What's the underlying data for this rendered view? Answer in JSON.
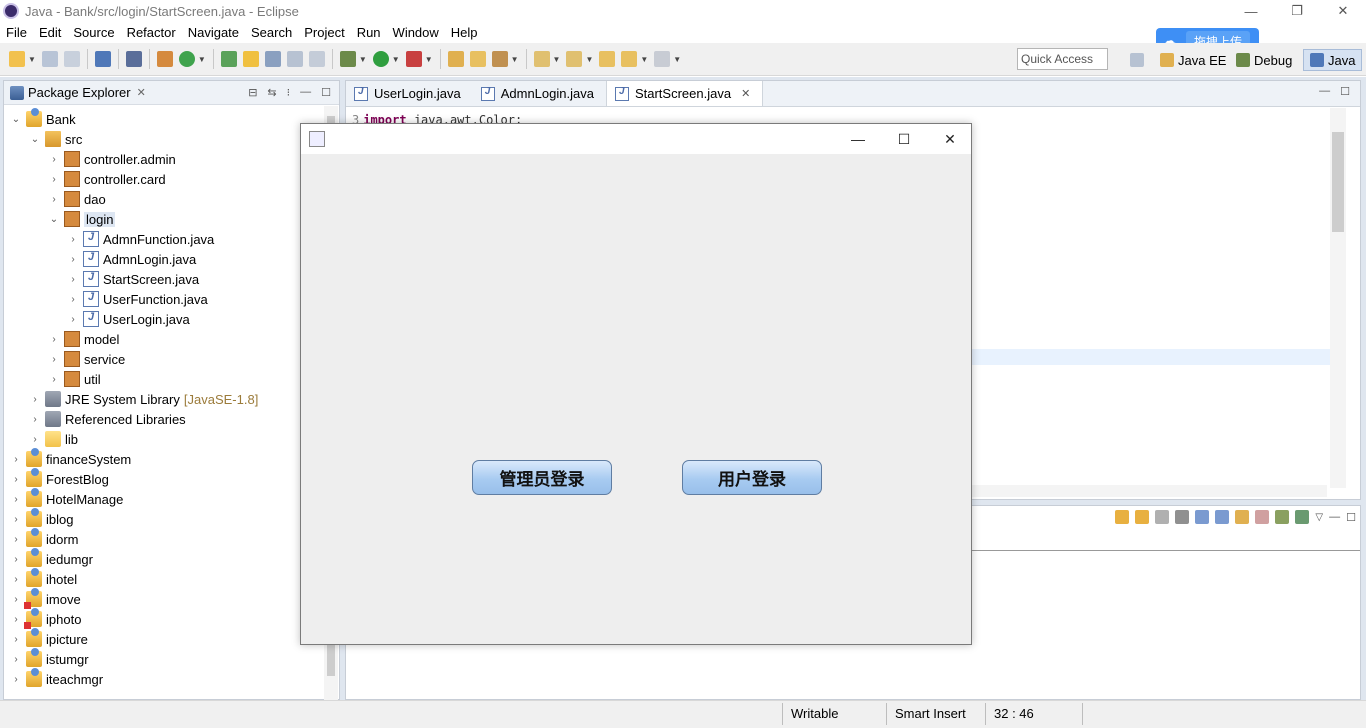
{
  "window": {
    "title": "Java - Bank/src/login/StartScreen.java - Eclipse",
    "controls": [
      "—",
      "❐",
      "✕"
    ]
  },
  "menu": [
    "File",
    "Edit",
    "Source",
    "Refactor",
    "Navigate",
    "Search",
    "Project",
    "Run",
    "Window",
    "Help"
  ],
  "toolbar": {
    "quick_access": "Quick Access",
    "perspectives": [
      "Java EE",
      "Debug",
      "Java"
    ],
    "upload_badge": "拖拽上传"
  },
  "package_explorer": {
    "title": "Package Explorer",
    "tree": [
      {
        "label": "Bank",
        "chevron": "⌄",
        "icon": "project"
      },
      {
        "label": "src",
        "chevron": "⌄",
        "icon": "src"
      },
      {
        "label": "controller.admin",
        "chevron": "›",
        "icon": "pkg"
      },
      {
        "label": "controller.card",
        "chevron": "›",
        "icon": "pkg"
      },
      {
        "label": "dao",
        "chevron": "›",
        "icon": "pkg"
      },
      {
        "label": "login",
        "chevron": "⌄",
        "icon": "pkg"
      },
      {
        "label": "AdmnFunction.java",
        "chevron": "›",
        "icon": "java"
      },
      {
        "label": "AdmnLogin.java",
        "chevron": "›",
        "icon": "java"
      },
      {
        "label": "StartScreen.java",
        "chevron": "›",
        "icon": "java"
      },
      {
        "label": "UserFunction.java",
        "chevron": "›",
        "icon": "java"
      },
      {
        "label": "UserLogin.java",
        "chevron": "›",
        "icon": "java"
      },
      {
        "label": "model",
        "chevron": "›",
        "icon": "pkg"
      },
      {
        "label": "service",
        "chevron": "›",
        "icon": "pkg"
      },
      {
        "label": "util",
        "chevron": "›",
        "icon": "pkg"
      },
      {
        "label": "JRE System Library",
        "suffix": "[JavaSE-1.8]",
        "chevron": "›",
        "icon": "lib"
      },
      {
        "label": "Referenced Libraries",
        "chevron": "›",
        "icon": "lib"
      },
      {
        "label": "lib",
        "chevron": "›",
        "icon": "folder"
      },
      {
        "label": "financeSystem",
        "chevron": "›",
        "icon": "project"
      },
      {
        "label": "ForestBlog",
        "chevron": "›",
        "icon": "project"
      },
      {
        "label": "HotelManage",
        "chevron": "›",
        "icon": "project"
      },
      {
        "label": "iblog",
        "chevron": "›",
        "icon": "project"
      },
      {
        "label": "idorm",
        "chevron": "›",
        "icon": "project"
      },
      {
        "label": "iedumgr",
        "chevron": "›",
        "icon": "project"
      },
      {
        "label": "ihotel",
        "chevron": "›",
        "icon": "project"
      },
      {
        "label": "imove",
        "chevron": "›",
        "icon": "project-error"
      },
      {
        "label": "iphoto",
        "chevron": "›",
        "icon": "project-error"
      },
      {
        "label": "ipicture",
        "chevron": "›",
        "icon": "project"
      },
      {
        "label": "istumgr",
        "chevron": "›",
        "icon": "project"
      },
      {
        "label": "iteachmgr",
        "chevron": "›",
        "icon": "project"
      }
    ]
  },
  "editor": {
    "tabs": [
      "UserLogin.java",
      "AdmnLogin.java",
      "StartScreen.java"
    ],
    "active_tab": "StartScreen.java",
    "line_number": "3",
    "code_keyword": "import",
    "code_rest": "java.awt.Color;"
  },
  "swing_window": {
    "buttons": [
      "管理员登录",
      "用户登录"
    ]
  },
  "statusbar": {
    "writable": "Writable",
    "insert_mode": "Smart Insert",
    "position": "32 : 46"
  }
}
